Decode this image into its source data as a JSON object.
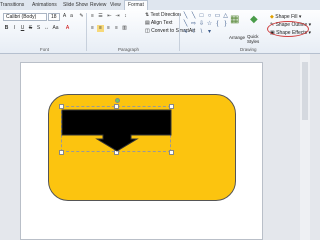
{
  "tabs": {
    "items": [
      "Transitions",
      "Animations",
      "Slide Show",
      "Review",
      "View",
      "Format"
    ],
    "active": "Format"
  },
  "ribbon": {
    "font": {
      "name": "Calibri (Body)",
      "size": "18",
      "group_label": "Font"
    },
    "paragraph": {
      "group_label": "Paragraph",
      "text_direction": "Text Direction",
      "align_text": "Align Text",
      "convert_smartart": "Convert to SmartArt"
    },
    "drawing": {
      "group_label": "Drawing",
      "arrange": "Arrange",
      "quick_styles": "Quick Styles",
      "shape_fill": "Shape Fill",
      "shape_outline": "Shape Outline",
      "shape_effects": "Shape Effects"
    }
  },
  "colors": {
    "shape_fill": "#fcc40f",
    "callout_fill": "#000000",
    "highlight_circle": "#d04040"
  }
}
